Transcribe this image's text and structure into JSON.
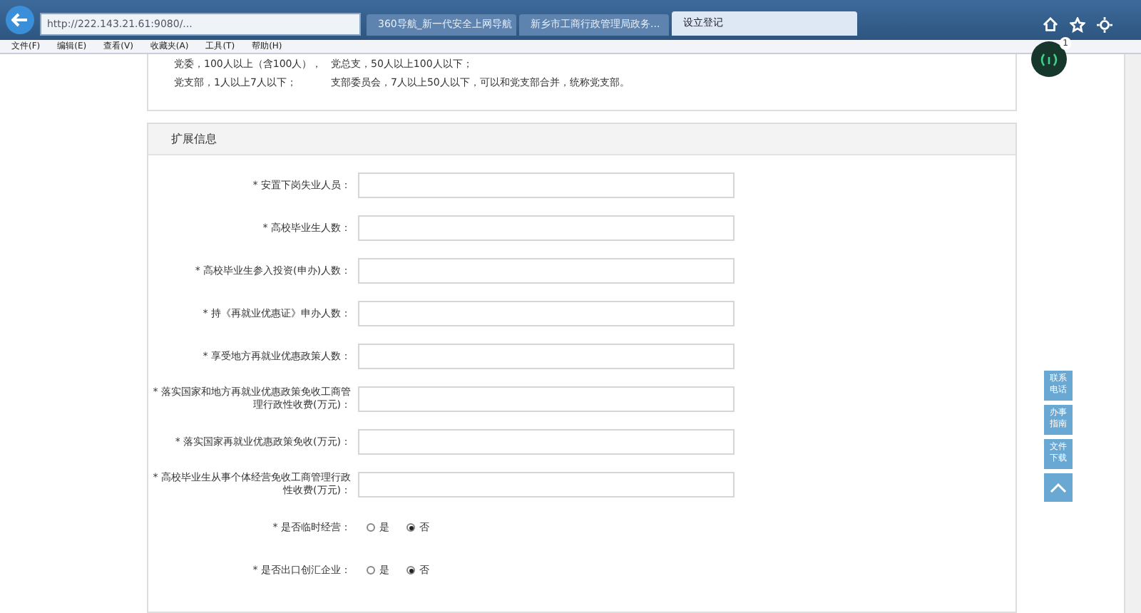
{
  "browser": {
    "address": "http://222.143.21.61:9080/...",
    "tabs": [
      {
        "label": "360导航_新一代安全上网导航",
        "selected": false
      },
      {
        "label": "新乡市工商行政管理局政务...",
        "selected": false
      },
      {
        "label": "设立登记",
        "selected": true
      }
    ],
    "menu": [
      "文件(F)",
      "编辑(E)",
      "查看(V)",
      "收藏夹(A)",
      "工具(T)",
      "帮助(H)"
    ],
    "notification_count": "1"
  },
  "notes": [
    [
      "党委，100人以上（含100人），",
      "党总支，50人以上100人以下；"
    ],
    [
      "党支部，1人以上7人以下；",
      "支部委员会，7人以上50人以下，可以和党支部合并，统称党支部。"
    ]
  ],
  "section": {
    "title": "扩展信息",
    "fields": [
      {
        "kind": "text",
        "label": "* 安置下岗失业人员："
      },
      {
        "kind": "text",
        "label": "* 高校毕业生人数："
      },
      {
        "kind": "text",
        "label": "* 高校毕业生参入投资(申办)人数："
      },
      {
        "kind": "text",
        "label": "* 持《再就业优惠证》申办人数："
      },
      {
        "kind": "text",
        "label": "* 享受地方再就业优惠政策人数："
      },
      {
        "kind": "text",
        "label": "* 落实国家和地方再就业优惠政策免收工商管理行政性收费(万元)："
      },
      {
        "kind": "text",
        "label": "* 落实国家再就业优惠政策免收(万元)："
      },
      {
        "kind": "text",
        "label": "* 高校毕业生从事个体经营免收工商管理行政性收费(万元)："
      },
      {
        "kind": "radio",
        "label": "* 是否临时经营：",
        "options": [
          {
            "label": "是",
            "selected": false
          },
          {
            "label": "否",
            "selected": true
          }
        ]
      },
      {
        "kind": "radio",
        "label": "* 是否出口创汇企业：",
        "options": [
          {
            "label": "是",
            "selected": false
          },
          {
            "label": "否",
            "selected": true
          }
        ]
      }
    ]
  },
  "side_buttons": [
    "联系电话",
    "办事指南",
    "文件下载"
  ]
}
